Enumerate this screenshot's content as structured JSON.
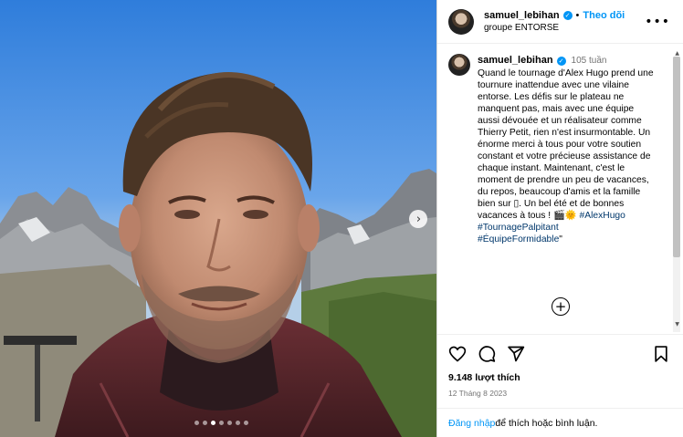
{
  "post": {
    "username": "samuel_lebihan",
    "header_separator": "•",
    "follow_label": "Theo dõi",
    "location": "groupe ENTORSE",
    "more_label": "•••",
    "time_ago": "105 tuần",
    "caption": "Quand le tournage d'Alex Hugo prend une tournure inattendue avec une vilaine entorse. Les défis sur le plateau ne manquent pas, mais avec une équipe aussi dévouée et un réalisateur comme Thierry Petit, rien n'est insurmontable. Un énorme merci à tous pour votre soutien constant et votre précieuse assistance de chaque instant. Maintenant, c'est le moment de prendre un peu de vacances, du repos, beaucoup d'amis et la famille bien sur ▯. Un bel été et de bonnes vacances à tous ! 🎬🌞",
    "inline_hashtag": "#AlexHugo",
    "hashtags": [
      "#TournagePalpitant",
      "#ÉquipeFormidable"
    ],
    "caption_tail": "\"",
    "add_comment_label": "+",
    "likes": "9.148 lượt thích",
    "date": "12 Tháng 8 2023",
    "login_link": "Đăng nhập",
    "login_suffix": " để thích hoặc bình luận."
  },
  "carousel": {
    "next_label": "›",
    "dot_count": 7,
    "active_dot": 2
  },
  "icons": {
    "verified": "verified-badge-icon",
    "heart": "heart-icon",
    "comment": "comment-icon",
    "share": "share-icon",
    "bookmark": "bookmark-icon"
  },
  "colors": {
    "accent": "#0095f6",
    "hashtag": "#00376b",
    "muted": "#737373"
  }
}
